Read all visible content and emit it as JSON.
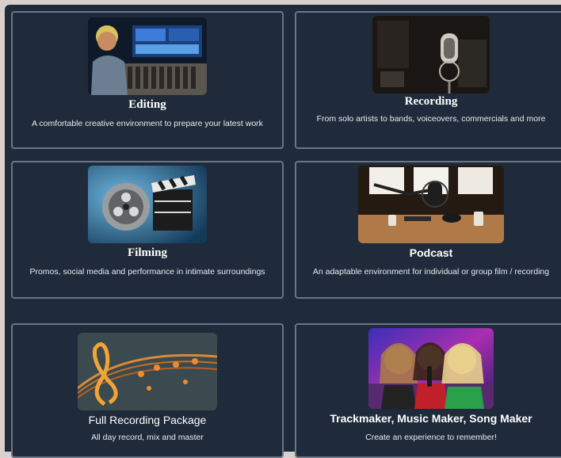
{
  "cards": [
    {
      "title": "Editing",
      "description": "A comfortable creative environment to prepare your latest work"
    },
    {
      "title": "Recording",
      "description": "From solo artists to bands, voiceovers, commercials and more"
    },
    {
      "title": "Filming",
      "description": "Promos, social media and performance in intimate surroundings"
    },
    {
      "title": "Podcast",
      "description": "An adaptable environment for individual or group film / recording"
    },
    {
      "title": "Full Recording Package",
      "description": "All day record, mix and master"
    },
    {
      "title": "Trackmaker, Music Maker, Song Maker",
      "description": "Create an experience to remember!"
    }
  ],
  "icons": {
    "editing": "studio-editing-photo",
    "recording": "microphone-photo",
    "filming": "film-reel-clapperboard-photo",
    "podcast": "podcast-microphone-photo",
    "full_package": "treble-clef-notes-photo",
    "trackmaker": "singing-friends-photo"
  },
  "colors": {
    "panel": "#1f2a3a",
    "card_border": "#6a7688",
    "text": "#ffffff"
  }
}
